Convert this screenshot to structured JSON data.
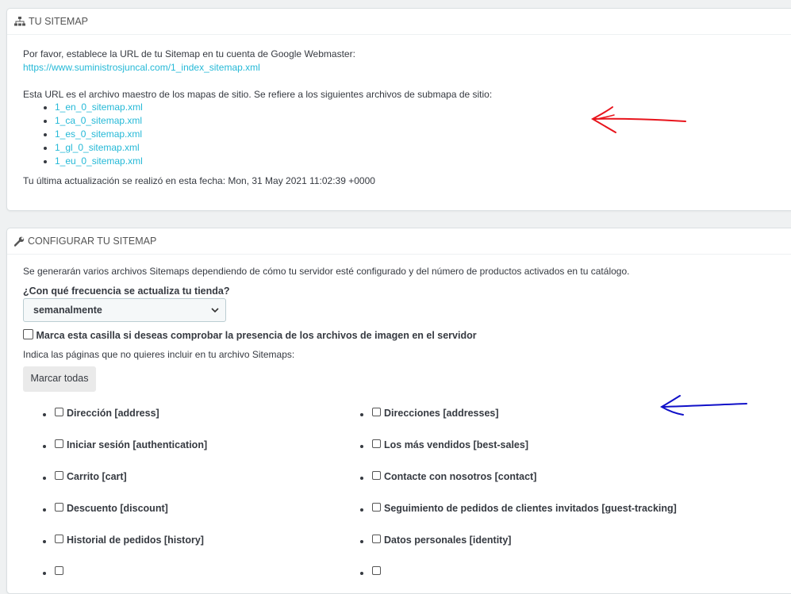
{
  "sitemap_panel": {
    "title": "TU SITEMAP",
    "intro": "Por favor, establece la URL de tu Sitemap en tu cuenta de Google Webmaster:",
    "index_url": "https://www.suministrosjuncal.com/1_index_sitemap.xml",
    "master_text": "Esta URL es el archivo maestro de los mapas de sitio. Se refiere a los siguientes archivos de submapa de sitio:",
    "submaps": [
      "1_en_0_sitemap.xml",
      "1_ca_0_sitemap.xml",
      "1_es_0_sitemap.xml",
      "1_gl_0_sitemap.xml",
      "1_eu_0_sitemap.xml"
    ],
    "last_update": "Tu última actualización se realizó en esta fecha: Mon, 31 May 2021 11:02:39 +0000"
  },
  "config_panel": {
    "title": "CONFIGURAR TU SITEMAP",
    "description": "Se generarán varios archivos Sitemaps dependiendo de cómo tu servidor esté configurado y del número de productos activados en tu catálogo.",
    "frequency_label": "¿Con qué frecuencia se actualiza tu tienda?",
    "frequency_value": "semanalmente",
    "image_check_label": "Marca esta casilla si deseas comprobar la presencia de los archivos de imagen en el servidor",
    "exclude_label": "Indica las páginas que no quieres incluir en tu archivo Sitemaps:",
    "mark_all_button": "Marcar todas",
    "pages_left": [
      "Dirección [address]",
      "Iniciar sesión [authentication]",
      "Carrito [cart]",
      "Descuento [discount]",
      "Historial de pedidos [history]"
    ],
    "pages_right": [
      "Direcciones [addresses]",
      "Los más vendidos [best-sales]",
      "Contacte con nosotros [contact]",
      "Seguimiento de pedidos de clientes invitados [guest-tracking]",
      "Datos personales [identity]"
    ]
  },
  "annotations": {
    "red_arrow_color": "#e8141c",
    "blue_arrow_color": "#1010c8"
  }
}
